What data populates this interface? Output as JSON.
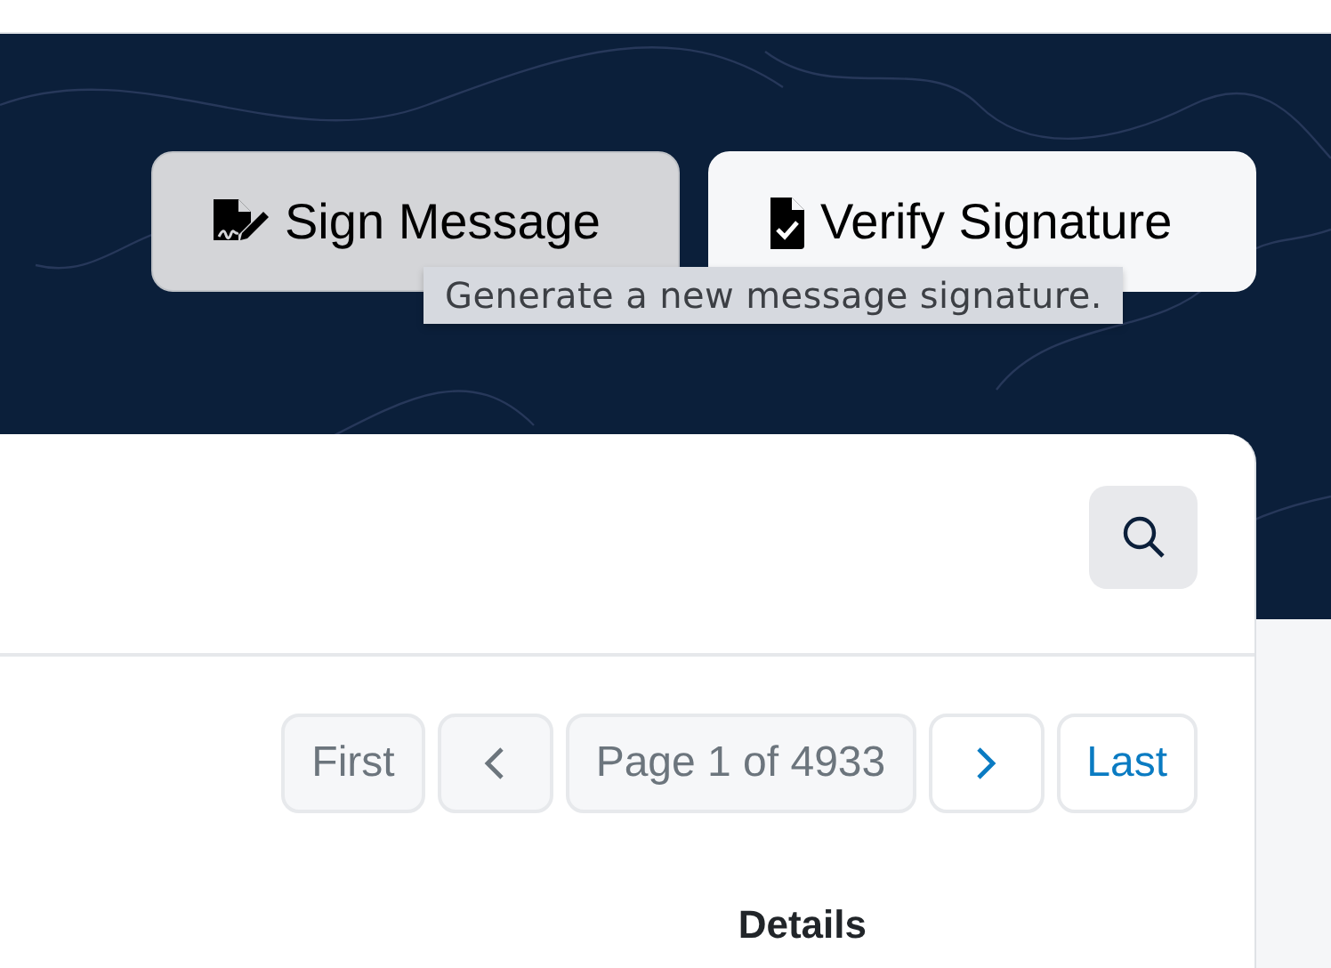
{
  "actions": [
    {
      "label": "Sign Message",
      "kind": "sign",
      "selected": true
    },
    {
      "label": "Verify Signature",
      "kind": "verify",
      "selected": false
    }
  ],
  "tooltip": "Generate a new message signature.",
  "pager": [
    {
      "kind": "text",
      "label": "First",
      "disabled": true
    },
    {
      "kind": "prev",
      "disabled": true
    },
    {
      "kind": "info",
      "label": "Page 1 of 4933"
    },
    {
      "kind": "next",
      "disabled": false
    },
    {
      "kind": "text",
      "label": "Last",
      "disabled": false
    }
  ],
  "table": {
    "columns": [
      "Details"
    ]
  }
}
